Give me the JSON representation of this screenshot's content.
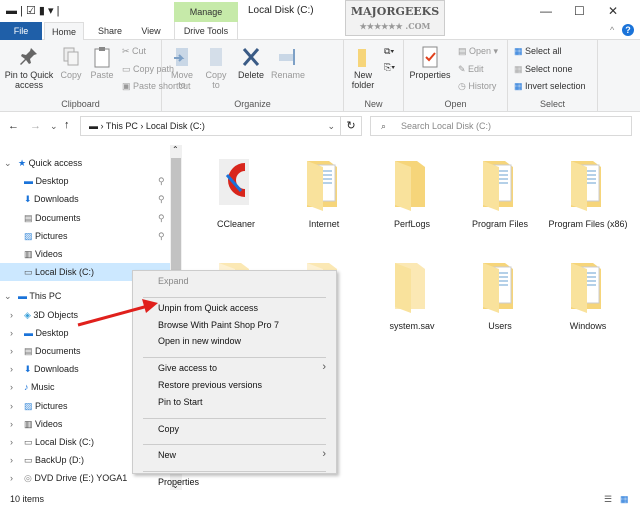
{
  "window": {
    "title": "Local Disk (C:)",
    "manage_tab": "Manage",
    "drive_tools_tab": "Drive Tools",
    "logo_text": "MAJORGEEKS",
    "logo_sub": ".COM"
  },
  "tabs": [
    "File",
    "Home",
    "Share",
    "View"
  ],
  "ribbon": {
    "clipboard": {
      "label": "Clipboard",
      "pin": "Pin to Quick access",
      "copy": "Copy",
      "paste": "Paste",
      "cut": "Cut",
      "copy_path": "Copy path",
      "paste_shortcut": "Paste shortcut"
    },
    "organize": {
      "label": "Organize",
      "move_to": "Move to",
      "copy_to": "Copy to",
      "delete": "Delete",
      "rename": "Rename"
    },
    "new": {
      "label": "New",
      "new_folder": "New folder"
    },
    "open": {
      "label": "Open",
      "properties": "Properties",
      "open": "Open",
      "edit": "Edit",
      "history": "History"
    },
    "select": {
      "label": "Select",
      "select_all": "Select all",
      "select_none": "Select none",
      "invert": "Invert selection"
    }
  },
  "address": {
    "path": [
      "This PC",
      "Local Disk (C:)"
    ],
    "search_placeholder": "Search Local Disk (C:)"
  },
  "nav": [
    {
      "label": "Quick access",
      "icon": "star-icon",
      "level": 0,
      "expand": true
    },
    {
      "label": "Desktop",
      "icon": "desktop-icon",
      "level": 1,
      "pinned": true
    },
    {
      "label": "Downloads",
      "icon": "download-icon",
      "level": 1,
      "pinned": true
    },
    {
      "label": "Documents",
      "icon": "documents-icon",
      "level": 1,
      "pinned": true
    },
    {
      "label": "Pictures",
      "icon": "pictures-icon",
      "level": 1,
      "pinned": true
    },
    {
      "label": "Videos",
      "icon": "videos-icon",
      "level": 1
    },
    {
      "label": "Local Disk (C:)",
      "icon": "drive-icon",
      "level": 1,
      "selected": true
    },
    {
      "label": "This PC",
      "icon": "computer-icon",
      "level": 0,
      "expand": true,
      "gap": true
    },
    {
      "label": "3D Objects",
      "icon": "cube-icon",
      "level": 1,
      "chev": true
    },
    {
      "label": "Desktop",
      "icon": "desktop-icon",
      "level": 1,
      "chev": true
    },
    {
      "label": "Documents",
      "icon": "documents-icon",
      "level": 1,
      "chev": true
    },
    {
      "label": "Downloads",
      "icon": "download-icon",
      "level": 1,
      "chev": true
    },
    {
      "label": "Music",
      "icon": "music-icon",
      "level": 1,
      "chev": true
    },
    {
      "label": "Pictures",
      "icon": "pictures-icon",
      "level": 1,
      "chev": true
    },
    {
      "label": "Videos",
      "icon": "videos-icon",
      "level": 1,
      "chev": true
    },
    {
      "label": "Local Disk (C:)",
      "icon": "drive-icon",
      "level": 1,
      "chev": true
    },
    {
      "label": "BackUp (D:)",
      "icon": "drive-icon",
      "level": 1,
      "chev": true
    },
    {
      "label": "DVD Drive (E:) YOGA1",
      "icon": "dvd-icon",
      "level": 1,
      "chev": true
    }
  ],
  "files": [
    {
      "name": "CCleaner",
      "type": "ccleaner"
    },
    {
      "name": "Internet",
      "type": "folder-docs"
    },
    {
      "name": "PerfLogs",
      "type": "folder"
    },
    {
      "name": "Program Files",
      "type": "folder-docs"
    },
    {
      "name": "Program Files (x86)",
      "type": "folder-docs"
    },
    {
      "name": "",
      "type": "folder-hidden"
    },
    {
      "name": "",
      "type": "folder-hidden"
    },
    {
      "name": "system.sav",
      "type": "folder-light"
    },
    {
      "name": "Users",
      "type": "folder-docs"
    },
    {
      "name": "Windows",
      "type": "folder-docs"
    }
  ],
  "context_menu": [
    {
      "label": "Expand",
      "disabled": true
    },
    {
      "sep": true
    },
    {
      "label": "Unpin from Quick access"
    },
    {
      "label": "Browse With Paint Shop Pro 7"
    },
    {
      "label": "Open in new window"
    },
    {
      "sep": true
    },
    {
      "label": "Give access to",
      "submenu": true
    },
    {
      "label": "Restore previous versions"
    },
    {
      "label": "Pin to Start"
    },
    {
      "sep": true
    },
    {
      "label": "Copy"
    },
    {
      "sep": true
    },
    {
      "label": "New",
      "submenu": true
    },
    {
      "sep": true
    },
    {
      "label": "Properties"
    }
  ],
  "status": {
    "items": "10 items"
  },
  "colors": {
    "accent": "#1f5fa8",
    "folder": "#f6d57a",
    "selection": "#cce8ff",
    "arrow": "#e0201c",
    "manage": "#c6eaa9"
  }
}
